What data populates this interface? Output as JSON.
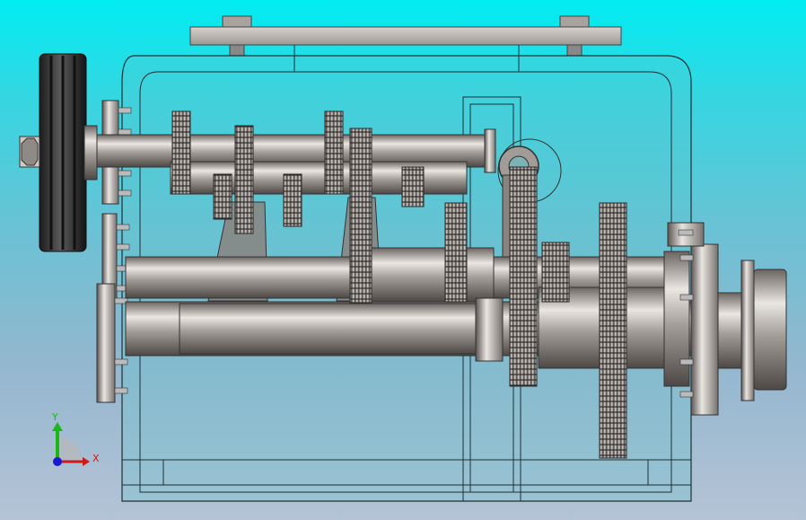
{
  "viewport": {
    "background_top": "#00ecf2",
    "background_bottom": "#b5c3d6"
  },
  "triad": {
    "x_label": "X",
    "y_label": "Y",
    "x_color": "#d01818",
    "y_color": "#18b818",
    "z_color": "#1818d0"
  },
  "model": {
    "housing_color": "#5fc4cc",
    "steel_color": "#9a9490",
    "gear_color": "#6e6a66",
    "pulley_color": "#2c2c2c"
  }
}
